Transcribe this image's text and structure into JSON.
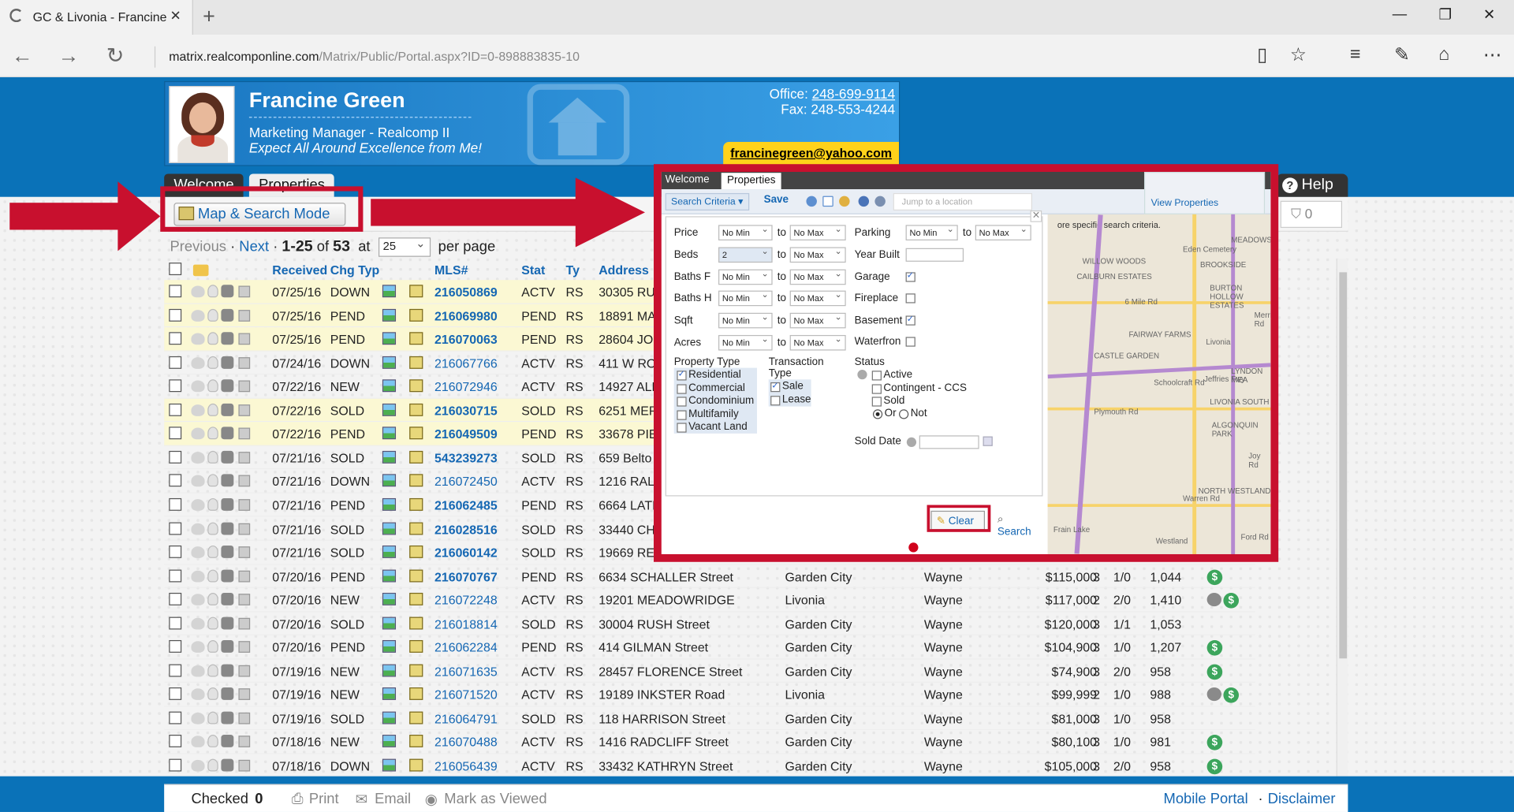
{
  "browser": {
    "tab_title": "GC & Livonia - Francine",
    "url_host": "matrix.realcomponline.com",
    "url_path": "/Matrix/Public/Portal.aspx?ID=0-898883835-10"
  },
  "agent": {
    "name": "Francine Green",
    "title": "Marketing Manager - Realcomp II",
    "tagline": "Expect All Around Excellence from Me!",
    "office_label": "Office:",
    "office_phone": "248-699-9114",
    "fax": "Fax: 248-553-4244",
    "email": "francinegreen@yahoo.com"
  },
  "tabs": {
    "welcome": "Welcome",
    "properties": "Properties",
    "help": "Help"
  },
  "toolbar": {
    "map_search": "Map & Search Mode",
    "cart_count": "0"
  },
  "pager": {
    "previous": "Previous",
    "sep1": "·",
    "next": "Next",
    "sep2": "·",
    "range": "1-25",
    "of": "of",
    "total": "53",
    "at": "at",
    "per_page_value": "25",
    "per_page": "per page"
  },
  "table": {
    "headers": {
      "received": "Received",
      "chg_type": "Chg Typ",
      "mls": "MLS#",
      "stat": "Stat",
      "ty": "Ty",
      "address": "Address"
    },
    "rows": [
      {
        "date": "07/25/16",
        "chg": "DOWN",
        "mls": "216050869",
        "stat": "ACTV",
        "ty": "RS",
        "address": "30305 RU",
        "highlight": true,
        "bold": true
      },
      {
        "date": "07/25/16",
        "chg": "PEND",
        "mls": "216069980",
        "stat": "PEND",
        "ty": "RS",
        "address": "18891 MA",
        "highlight": true,
        "bold": true
      },
      {
        "date": "07/25/16",
        "chg": "PEND",
        "mls": "216070063",
        "stat": "PEND",
        "ty": "RS",
        "address": "28604 JOI",
        "highlight": true,
        "bold": true
      },
      {
        "date": "07/24/16",
        "chg": "DOWN",
        "mls": "216067766",
        "stat": "ACTV",
        "ty": "RS",
        "address": "411 W RO",
        "highlight": false,
        "bold": false
      },
      {
        "date": "07/22/16",
        "chg": "NEW",
        "mls": "216072946",
        "stat": "ACTV",
        "ty": "RS",
        "address": "14927 ALE",
        "highlight": false,
        "bold": false
      },
      {
        "date": "07/22/16",
        "chg": "SOLD",
        "mls": "216030715",
        "stat": "SOLD",
        "ty": "RS",
        "address": "6251 MER",
        "highlight": true,
        "bold": true
      },
      {
        "date": "07/22/16",
        "chg": "PEND",
        "mls": "216049509",
        "stat": "PEND",
        "ty": "RS",
        "address": "33678 PIE",
        "highlight": true,
        "bold": true
      },
      {
        "date": "07/21/16",
        "chg": "SOLD",
        "mls": "543239273",
        "stat": "SOLD",
        "ty": "RS",
        "address": "659 Belto",
        "highlight": false,
        "bold": true
      },
      {
        "date": "07/21/16",
        "chg": "DOWN",
        "mls": "216072450",
        "stat": "ACTV",
        "ty": "RS",
        "address": "1216 RAL",
        "highlight": false,
        "bold": false
      },
      {
        "date": "07/21/16",
        "chg": "PEND",
        "mls": "216062485",
        "stat": "PEND",
        "ty": "RS",
        "address": "6664 LATI",
        "highlight": false,
        "bold": true
      },
      {
        "date": "07/21/16",
        "chg": "SOLD",
        "mls": "216028516",
        "stat": "SOLD",
        "ty": "RS",
        "address": "33440 CH",
        "highlight": false,
        "bold": true
      },
      {
        "date": "07/21/16",
        "chg": "SOLD",
        "mls": "216060142",
        "stat": "SOLD",
        "ty": "RS",
        "address": "19669 REI",
        "highlight": false,
        "bold": true
      },
      {
        "date": "07/20/16",
        "chg": "PEND",
        "mls": "216070767",
        "stat": "PEND",
        "ty": "RS",
        "address": "6634 SCHALLER Street",
        "city": "Garden City",
        "county": "Wayne",
        "price": "$115,000",
        "beds": "3",
        "baths": "1/0",
        "sqft": "1,044",
        "icons": "dollar",
        "highlight": false,
        "bold": true
      },
      {
        "date": "07/20/16",
        "chg": "NEW",
        "mls": "216072248",
        "stat": "ACTV",
        "ty": "RS",
        "address": "19201 MEADOWRIDGE",
        "city": "Livonia",
        "county": "Wayne",
        "price": "$117,000",
        "beds": "2",
        "baths": "2/0",
        "sqft": "1,410",
        "icons": "cam-dollar",
        "highlight": false,
        "bold": false
      },
      {
        "date": "07/20/16",
        "chg": "SOLD",
        "mls": "216018814",
        "stat": "SOLD",
        "ty": "RS",
        "address": "30004 RUSH Street",
        "city": "Garden City",
        "county": "Wayne",
        "price": "$120,000",
        "beds": "3",
        "baths": "1/1",
        "sqft": "1,053",
        "icons": "",
        "highlight": false,
        "bold": false
      },
      {
        "date": "07/20/16",
        "chg": "PEND",
        "mls": "216062284",
        "stat": "PEND",
        "ty": "RS",
        "address": "414 GILMAN Street",
        "city": "Garden City",
        "county": "Wayne",
        "price": "$104,900",
        "beds": "3",
        "baths": "1/0",
        "sqft": "1,207",
        "icons": "dollar",
        "highlight": false,
        "bold": false
      },
      {
        "date": "07/19/16",
        "chg": "NEW",
        "mls": "216071635",
        "stat": "ACTV",
        "ty": "RS",
        "address": "28457 FLORENCE Street",
        "city": "Garden City",
        "county": "Wayne",
        "price": "$74,900",
        "beds": "3",
        "baths": "2/0",
        "sqft": "958",
        "icons": "dollar",
        "highlight": false,
        "bold": false
      },
      {
        "date": "07/19/16",
        "chg": "NEW",
        "mls": "216071520",
        "stat": "ACTV",
        "ty": "RS",
        "address": "19189 INKSTER Road",
        "city": "Livonia",
        "county": "Wayne",
        "price": "$99,999",
        "beds": "2",
        "baths": "1/0",
        "sqft": "988",
        "icons": "cam-dollar",
        "highlight": false,
        "bold": false
      },
      {
        "date": "07/19/16",
        "chg": "SOLD",
        "mls": "216064791",
        "stat": "SOLD",
        "ty": "RS",
        "address": "118 HARRISON Street",
        "city": "Garden City",
        "county": "Wayne",
        "price": "$81,000",
        "beds": "3",
        "baths": "1/0",
        "sqft": "958",
        "icons": "",
        "highlight": false,
        "bold": false
      },
      {
        "date": "07/18/16",
        "chg": "NEW",
        "mls": "216070488",
        "stat": "ACTV",
        "ty": "RS",
        "address": "1416 RADCLIFF Street",
        "city": "Garden City",
        "county": "Wayne",
        "price": "$80,100",
        "beds": "3",
        "baths": "1/0",
        "sqft": "981",
        "icons": "dollar",
        "highlight": false,
        "bold": false
      },
      {
        "date": "07/18/16",
        "chg": "DOWN",
        "mls": "216056439",
        "stat": "ACTV",
        "ty": "RS",
        "address": "33432 KATHRYN Street",
        "city": "Garden City",
        "county": "Wayne",
        "price": "$105,000",
        "beds": "3",
        "baths": "2/0",
        "sqft": "958",
        "icons": "dollar",
        "highlight": false,
        "bold": false
      }
    ]
  },
  "footer": {
    "checked": "Checked",
    "checked_count": "0",
    "print": "Print",
    "email": "Email",
    "mark_viewed": "Mark as Viewed",
    "mobile_portal": "Mobile Portal",
    "sep": "·",
    "disclaimer": "Disclaimer"
  },
  "panel": {
    "tab_welcome": "Welcome",
    "tab_properties": "Properties",
    "search_criteria": "Search Criteria",
    "save": "Save",
    "jump_placeholder": "Jump to a location",
    "view_properties": "View Properties",
    "hint": "ore specific search criteria.",
    "to": "to",
    "no_min": "No Min",
    "no_max": "No Max",
    "fields_left": [
      {
        "label": "Price",
        "min": "No Min"
      },
      {
        "label": "Beds",
        "min": "2"
      },
      {
        "label": "Baths F",
        "min": "No Min"
      },
      {
        "label": "Baths H",
        "min": "No Min"
      },
      {
        "label": "Sqft",
        "min": "No Min"
      },
      {
        "label": "Acres",
        "min": "No Min"
      }
    ],
    "fields_right": {
      "parking": "Parking",
      "year_built": "Year Built",
      "garage": "Garage",
      "fireplace": "Fireplace",
      "basement": "Basement",
      "waterfront": "Waterfron"
    },
    "property_type_label": "Property Type",
    "property_types": [
      "Residential",
      "Commercial",
      "Condominium",
      "Multifamily",
      "Vacant Land"
    ],
    "transaction_label_1": "Transaction",
    "transaction_label_2": "Type",
    "transaction_types": [
      "Sale",
      "Lease"
    ],
    "status_label": "Status",
    "statuses": [
      "Active",
      "Contingent - CCS",
      "Sold"
    ],
    "or_label": "Or",
    "not_label": "Not",
    "sold_date": "Sold Date",
    "clear": "Clear",
    "search": "Search"
  },
  "map": {
    "labels": [
      "MEADOWS",
      "Eden Cemetery",
      "WILLOW WOODS",
      "BROOKSIDE",
      "CAILBURN ESTATES",
      "BURTON HOLLOW ESTATES",
      "6 Mile Rd",
      "FAIRWAY FARMS",
      "Livonia",
      "CASTLE GARDEN",
      "LYNDON MEA",
      "Schoolcraft Rd",
      "Jeffries Fwy",
      "LIVONIA SOUTH",
      "Plymouth Rd",
      "ALGONQUIN PARK",
      "Joy Rd",
      "NORTH WESTLAND",
      "Warren Rd",
      "Frain Lake",
      "Westland",
      "Ford Rd",
      "Merriman Rd"
    ]
  },
  "colors": {
    "brand_blue": "#0a72b8",
    "highlight_red": "#c8102e",
    "link_blue": "#1567b3",
    "row_yellow": "#fbf8d3",
    "email_yellow": "#ffd21a"
  }
}
